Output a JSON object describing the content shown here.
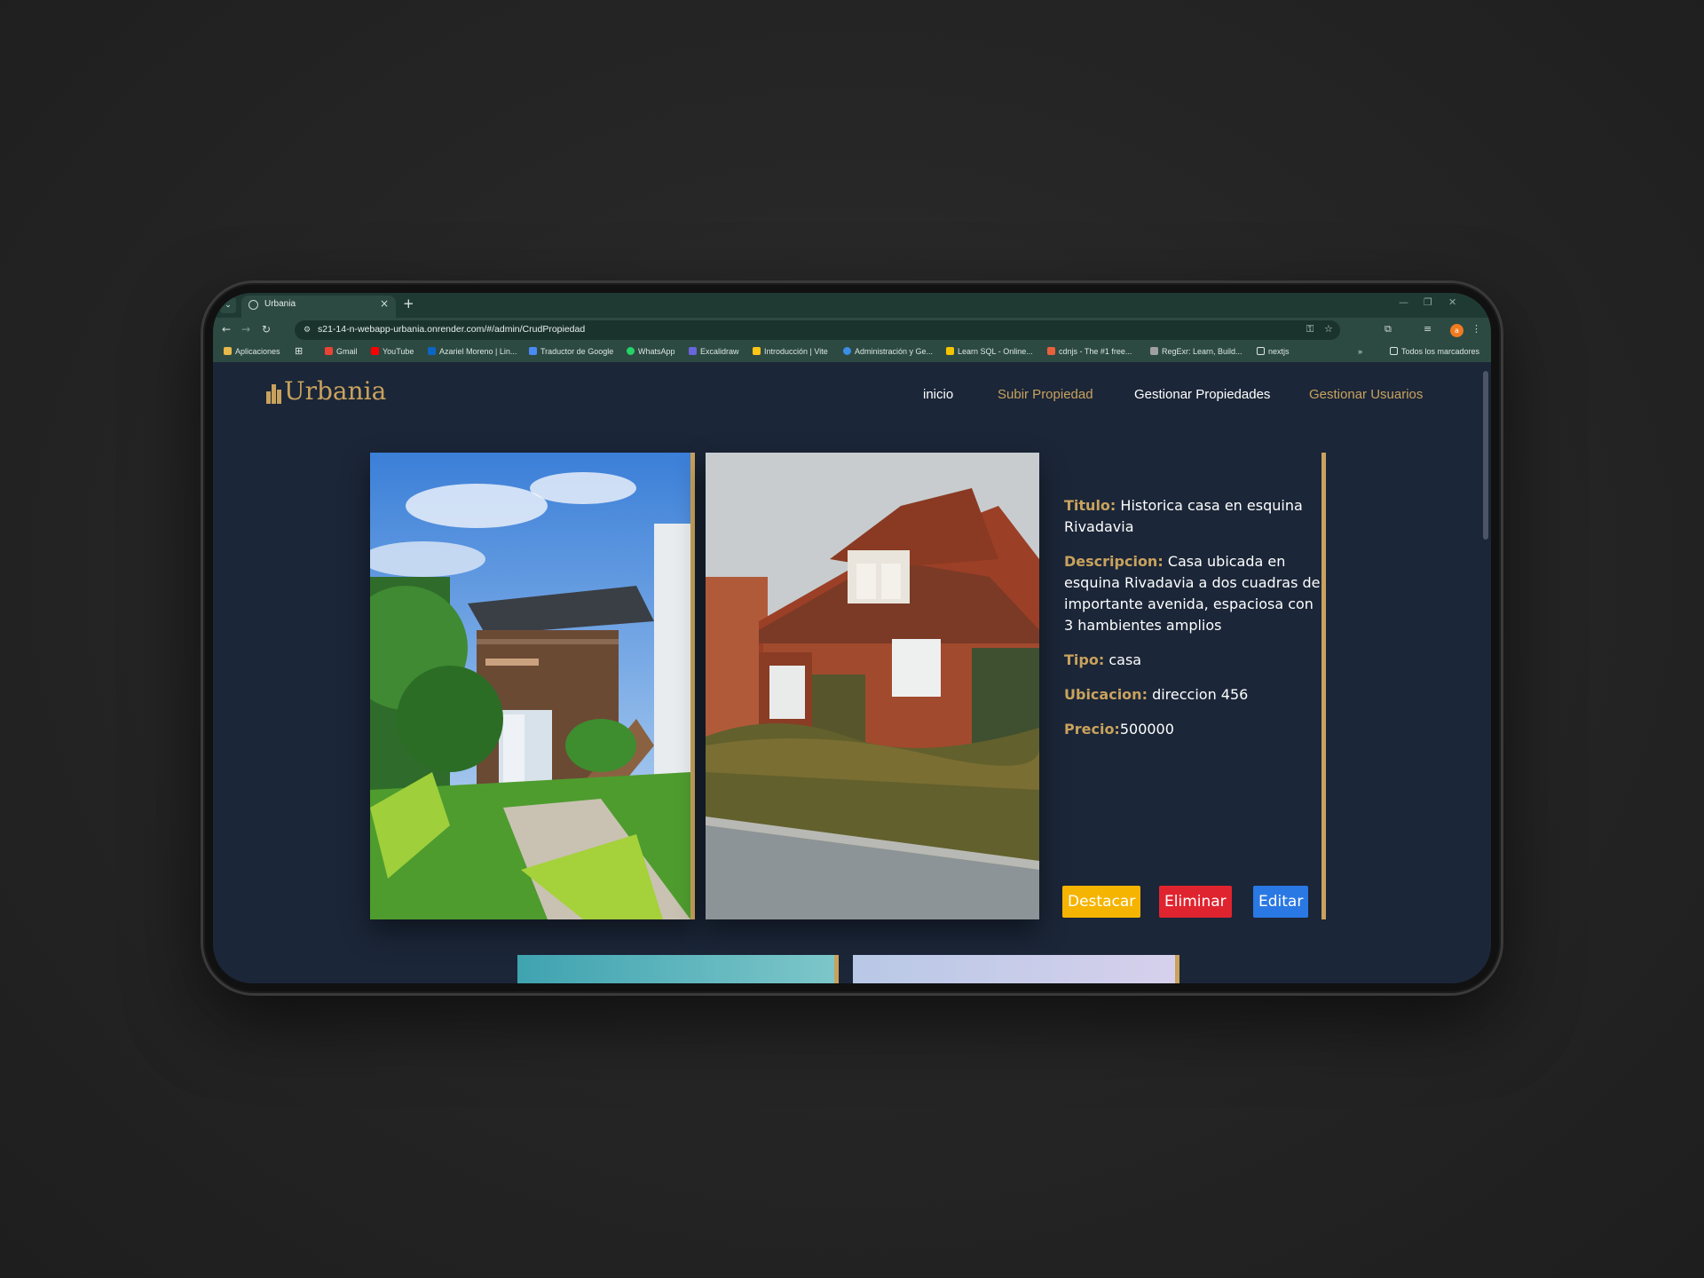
{
  "browser": {
    "tab_title": "Urbania",
    "new_tab_label": "+",
    "url": "s21-14-n-webapp-urbania.onrender.com/#/admin/CrudPropiedad",
    "bookmarks": [
      {
        "label": "Aplicaciones",
        "icon": "apps-grid-icon",
        "color": "#e8b84a"
      },
      {
        "label": "Gmail",
        "icon": "gmail-icon",
        "color": "#ea4335"
      },
      {
        "label": "YouTube",
        "icon": "youtube-icon",
        "color": "#ff0000"
      },
      {
        "label": "Azariel Moreno | Lin...",
        "icon": "linkedin-icon",
        "color": "#0a66c2"
      },
      {
        "label": "Traductor de Google",
        "icon": "translate-icon",
        "color": "#4a8af4"
      },
      {
        "label": "WhatsApp",
        "icon": "whatsapp-icon",
        "color": "#25d366"
      },
      {
        "label": "Excalidraw",
        "icon": "excalidraw-icon",
        "color": "#6965db"
      },
      {
        "label": "Introducción | Vite",
        "icon": "vite-icon",
        "color": "#ffc517"
      },
      {
        "label": "Administración y Ge...",
        "icon": "edge-icon",
        "color": "#3a8ee6"
      },
      {
        "label": "Learn SQL - Online...",
        "icon": "sql-icon",
        "color": "#f5c400"
      },
      {
        "label": "cdnjs - The #1 free...",
        "icon": "code-icon",
        "color": "#e8613c"
      },
      {
        "label": "RegExr: Learn, Build...",
        "icon": "regexr-icon",
        "color": "#a0a0a0"
      },
      {
        "label": "nextjs",
        "icon": "folder-icon",
        "color": "#dbe6e3"
      }
    ],
    "all_bookmarks_label": "Todos los marcadores",
    "avatar_letter": "a"
  },
  "site": {
    "logo_text": "Urbania",
    "nav": [
      {
        "label": "inicio",
        "color": "#ffffff"
      },
      {
        "label": "Subir Propiedad",
        "color": "#c9a25d"
      },
      {
        "label": "Gestionar Propiedades",
        "color": "#ffffff"
      },
      {
        "label": "Gestionar Usuarios",
        "color": "#c9a25d"
      }
    ]
  },
  "property": {
    "titulo_label": "Titulo:",
    "titulo": "Historica casa en esquina Rivadavia",
    "descripcion_label": "Descripcion:",
    "descripcion": "Casa ubicada en esquina Rivadavia a dos cuadras de importante avenida, espaciosa con 3 hambientes amplios",
    "tipo_label": "Tipo:",
    "tipo": "casa",
    "ubicacion_label": "Ubicacion:",
    "ubicacion": "direccion 456",
    "precio_label": "Precio:",
    "precio": "500000",
    "buttons": {
      "destacar": "Destacar",
      "eliminar": "Eliminar",
      "editar": "Editar"
    }
  },
  "colors": {
    "accent_gold": "#c9a25d",
    "page_bg": "#1b2638",
    "btn_destacar": "#f5b400",
    "btn_eliminar": "#e0242f",
    "btn_editar": "#2a78e4"
  }
}
